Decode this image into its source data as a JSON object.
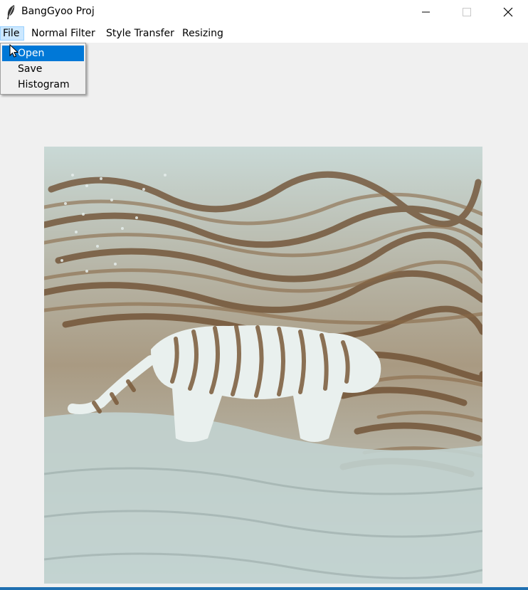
{
  "window": {
    "title": "BangGyoo Proj",
    "icon": "feather-icon",
    "controls": [
      "minimize-icon",
      "maximize-icon",
      "close-icon"
    ]
  },
  "menubar": {
    "items": [
      "File",
      "Normal Filter",
      "Style Transfer",
      "Resizing"
    ]
  },
  "file_menu": {
    "items": [
      "Open",
      "Save",
      "Histogram"
    ],
    "highlighted": "Open"
  },
  "canvas": {
    "content": "style-transferred image of a white tiger walking"
  },
  "colors": {
    "menu_highlight": "#0078d7",
    "menu_active_bg": "#cce8ff",
    "window_bg": "#f0f0f0"
  }
}
